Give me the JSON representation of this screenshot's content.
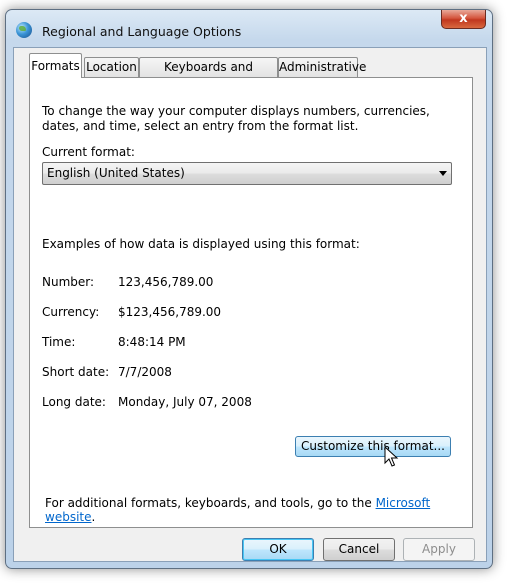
{
  "window": {
    "title": "Regional and Language Options",
    "close_label": "x"
  },
  "tabs": [
    {
      "label": "Formats",
      "active": true
    },
    {
      "label": "Location",
      "active": false
    },
    {
      "label": "Keyboards and Languages",
      "active": false
    },
    {
      "label": "Administrative",
      "active": false
    }
  ],
  "formats": {
    "intro": "To change the way your computer displays numbers, currencies, dates, and time, select an entry from the format list.",
    "current_format_label": "Current format:",
    "current_format_value": "English (United States)",
    "examples_title": "Examples of how data is displayed using this format:",
    "examples": [
      {
        "label": "Number:",
        "value": "123,456,789.00"
      },
      {
        "label": "Currency:",
        "value": "$123,456,789.00"
      },
      {
        "label": "Time:",
        "value": "8:48:14 PM"
      },
      {
        "label": "Short date:",
        "value": "7/7/2008"
      },
      {
        "label": "Long date:",
        "value": "Monday, July 07, 2008"
      }
    ],
    "customize_label": "Customize this format...",
    "footer_text": "For additional formats, keyboards, and tools, go to the ",
    "footer_link": "Microsoft website",
    "footer_end": "."
  },
  "buttons": {
    "ok": "OK",
    "cancel": "Cancel",
    "apply": "Apply"
  },
  "icons": {
    "app": "globe-icon",
    "close": "close-icon",
    "dropdown": "chevron-down-icon",
    "cursor": "mouse-pointer-icon"
  }
}
